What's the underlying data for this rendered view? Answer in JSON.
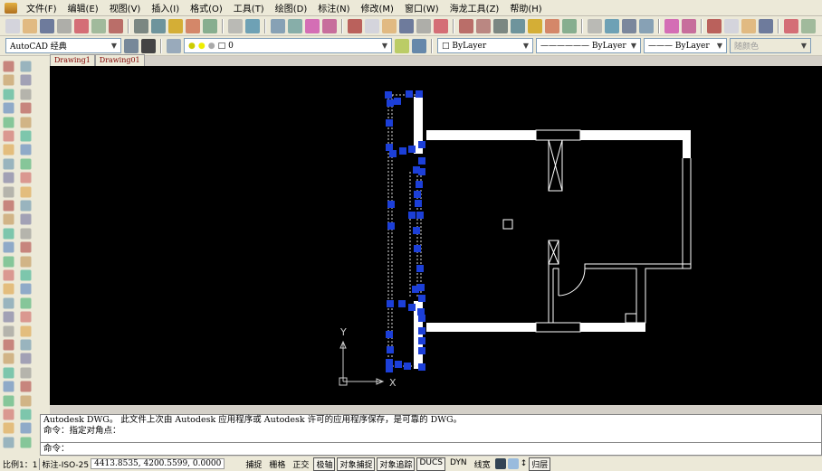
{
  "menu": [
    "文件(F)",
    "编辑(E)",
    "视图(V)",
    "插入(I)",
    "格式(O)",
    "工具(T)",
    "绘图(D)",
    "标注(N)",
    "修改(M)",
    "窗口(W)",
    "海龙工具(Z)",
    "帮助(H)"
  ],
  "workspace": "AutoCAD 经典",
  "layer": "0",
  "color": "ByLayer",
  "linetype": "ByLayer",
  "lineweight": "ByLayer",
  "plotstyle": "随颜色",
  "tabs": [
    "Drawing1",
    "Drawing01"
  ],
  "ucs": {
    "x": "X",
    "y": "Y"
  },
  "command": {
    "line1": "Autodesk DWG。  此文件上次由 Autodesk 应用程序或 Autodesk 许可的应用程序保存，是可靠的 DWG。",
    "line2": "命令：指定对角点：",
    "prompt": "命令："
  },
  "status": {
    "scale": "比例1：1",
    "dimstyle": "标注-ISO-25",
    "coords": "4413.8535, 4200.5599, 0.0000",
    "buttons": [
      {
        "label": "捕捉",
        "on": false
      },
      {
        "label": "栅格",
        "on": false
      },
      {
        "label": "正交",
        "on": false
      },
      {
        "label": "极轴",
        "on": true
      },
      {
        "label": "对象捕捉",
        "on": true
      },
      {
        "label": "对象追踪",
        "on": true
      },
      {
        "label": "DUCS",
        "on": true
      },
      {
        "label": "DYN",
        "on": false
      },
      {
        "label": "线宽",
        "on": false
      }
    ],
    "layer_btn": "归层"
  },
  "colors": {
    "grip": "#1c3fd8",
    "canvas": "#000000"
  }
}
